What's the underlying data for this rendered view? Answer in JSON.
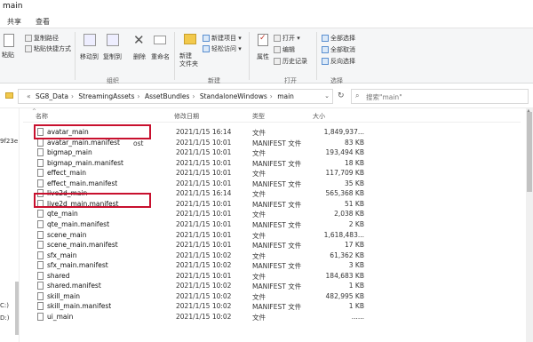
{
  "window": {
    "title": "main"
  },
  "tabs": [
    "共享",
    "查看"
  ],
  "ribbon": {
    "clipboard": {
      "cut": "",
      "copy_path": "复制路径",
      "paste": "粘贴",
      "paste_shortcut": "粘贴快捷方式",
      "label": ""
    },
    "organize": {
      "move_to": "移动到",
      "copy_to": "复制到",
      "delete": "删除",
      "rename": "重命名",
      "label": "组织"
    },
    "new": {
      "new_folder": "新建\n文件夹",
      "new_item": "新建项目",
      "easy_access": "轻松访问",
      "label": "新建"
    },
    "open": {
      "properties": "属性",
      "open": "打开",
      "edit": "编辑",
      "history": "历史记录",
      "label": "打开"
    },
    "select": {
      "select_all": "全部选择",
      "select_none": "全部取消",
      "invert": "反向选择",
      "label": "选择"
    }
  },
  "address": {
    "crumbs": [
      "SG8_Data",
      "StreamingAssets",
      "AssetBundles",
      "StandaloneWindows",
      "main"
    ],
    "search_placeholder": "搜索\"main\""
  },
  "nav": {
    "text1": "9f23e",
    "drive_c": "C:)",
    "drive_d": "D:)"
  },
  "columns": {
    "name": "名称",
    "date": "修改日期",
    "type": "类型",
    "size": "大小"
  },
  "files": [
    {
      "name": "avatar_main",
      "date": "2021/1/15 16:14",
      "type": "文件",
      "size": "1,849,937..."
    },
    {
      "name": "avatar_main.manifest",
      "date": "2021/1/15 10:01",
      "type": "MANIFEST 文件",
      "size": "83 KB"
    },
    {
      "name": "bigmap_main",
      "date": "2021/1/15 10:01",
      "type": "文件",
      "size": "193,494 KB"
    },
    {
      "name": "bigmap_main.manifest",
      "date": "2021/1/15 10:01",
      "type": "MANIFEST 文件",
      "size": "18 KB"
    },
    {
      "name": "effect_main",
      "date": "2021/1/15 10:01",
      "type": "文件",
      "size": "117,709 KB"
    },
    {
      "name": "effect_main.manifest",
      "date": "2021/1/15 10:01",
      "type": "MANIFEST 文件",
      "size": "35 KB"
    },
    {
      "name": "live2d_main",
      "date": "2021/1/15 16:14",
      "type": "文件",
      "size": "565,368 KB"
    },
    {
      "name": "live2d_main.manifest",
      "date": "2021/1/15 10:01",
      "type": "MANIFEST 文件",
      "size": "51 KB"
    },
    {
      "name": "qte_main",
      "date": "2021/1/15 10:01",
      "type": "文件",
      "size": "2,038 KB"
    },
    {
      "name": "qte_main.manifest",
      "date": "2021/1/15 10:01",
      "type": "MANIFEST 文件",
      "size": "2 KB"
    },
    {
      "name": "scene_main",
      "date": "2021/1/15 10:01",
      "type": "文件",
      "size": "1,618,483..."
    },
    {
      "name": "scene_main.manifest",
      "date": "2021/1/15 10:01",
      "type": "MANIFEST 文件",
      "size": "17 KB"
    },
    {
      "name": "sfx_main",
      "date": "2021/1/15 10:02",
      "type": "文件",
      "size": "61,362 KB"
    },
    {
      "name": "sfx_main.manifest",
      "date": "2021/1/15 10:02",
      "type": "MANIFEST 文件",
      "size": "3 KB"
    },
    {
      "name": "shared",
      "date": "2021/1/15 10:01",
      "type": "文件",
      "size": "184,683 KB"
    },
    {
      "name": "shared.manifest",
      "date": "2021/1/15 10:02",
      "type": "MANIFEST 文件",
      "size": "1 KB"
    },
    {
      "name": "skill_main",
      "date": "2021/1/15 10:02",
      "type": "文件",
      "size": "482,995 KB"
    },
    {
      "name": "skill_main.manifest",
      "date": "2021/1/15 10:02",
      "type": "MANIFEST 文件",
      "size": "1 KB"
    },
    {
      "name": "ui_main",
      "date": "2021/1/15 10:02",
      "type": "文件",
      "size": "......"
    }
  ],
  "stray_text": "ost",
  "colors": {
    "highlight_box": "#c8102e",
    "ribbon_bg": "#f5f6f7"
  }
}
